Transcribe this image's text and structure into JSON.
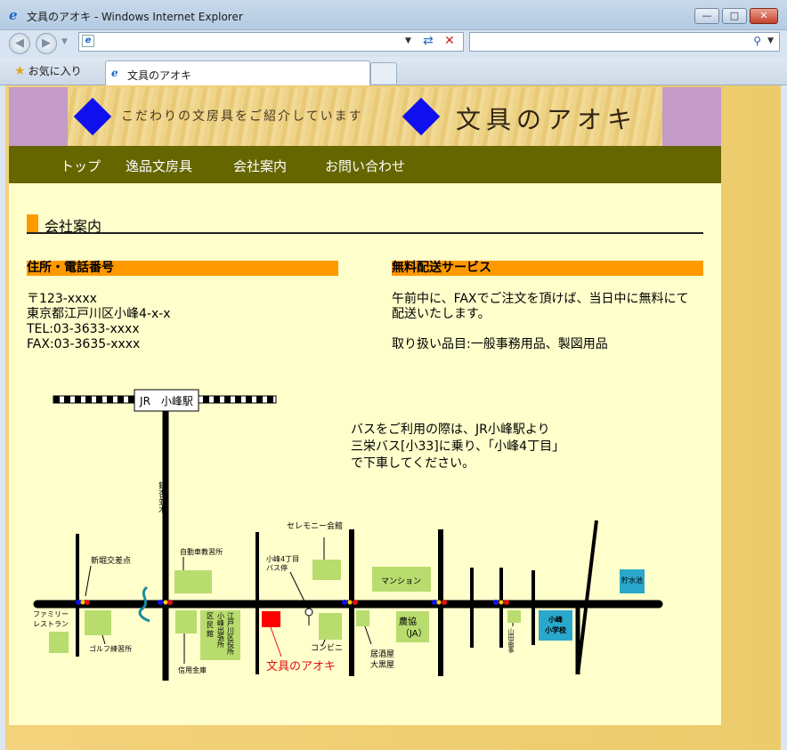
{
  "browser": {
    "window_title": "文具のアオキ - Windows Internet Explorer",
    "favorites_label": "お気に入り",
    "tab_label": "文具のアオキ",
    "address_value": "",
    "search_value": ""
  },
  "banner": {
    "tagline": "こだわりの文房具をご紹介しています",
    "shop_name": "文具のアオキ",
    "colors": {
      "side": "#c59bc8",
      "diamond": "#1010ee",
      "nav": "#666600",
      "accent": "#ff9900"
    }
  },
  "nav": {
    "items": [
      "トップ",
      "逸品文房具",
      "会社案内",
      "お問い合わせ"
    ]
  },
  "page": {
    "heading": "会社案内",
    "address": {
      "title": "住所・電話番号",
      "lines": [
        "〒123-xxxx",
        "東京都江戸川区小峰4-x-x",
        "TEL:03-3633-xxxx",
        "FAX:03-3635-xxxx"
      ]
    },
    "delivery": {
      "title": "無料配送サービス",
      "lines": [
        "午前中に、FAXでご注文を頂けば、当日中に無料にて",
        "配送いたします。",
        "",
        "取り扱い品目:一般事務用品、製図用品"
      ]
    },
    "bus_note": [
      "バスをご利用の際は、JR小峰駅より",
      "三栄バス[小33]に乗り、「小峰4丁目」",
      "で下車してください。"
    ]
  },
  "map": {
    "station": "JR　小峰駅",
    "avenue": "銀杏並木",
    "labels": {
      "shinbori": "新堀交差点",
      "jidosha": "自動車教習所",
      "family_1": "ファミリー",
      "family_2": "レストラン",
      "golf": "ゴルフ練習所",
      "shinyo": "信用金庫",
      "kumin_1": "区",
      "kumin_2": "民",
      "kumin_3": "館",
      "edogawa_1": "江戸川区役所",
      "edogawa_2": "小峰出張所",
      "busstop_1": "小峰4丁目",
      "busstop_2": "バス停",
      "ceremony": "セレモニー会館",
      "conbini": "コンビニ",
      "aoki": "文具のアオキ",
      "izakaya_1": "居酒屋",
      "izakaya_2": "大黒屋",
      "mansion": "マンション",
      "nokyo_1": "農協",
      "nokyo_2": "（JA）",
      "yamada": "山田歯事",
      "school_1": "小峰",
      "school_2": "小学校",
      "pond": "貯水池"
    }
  }
}
